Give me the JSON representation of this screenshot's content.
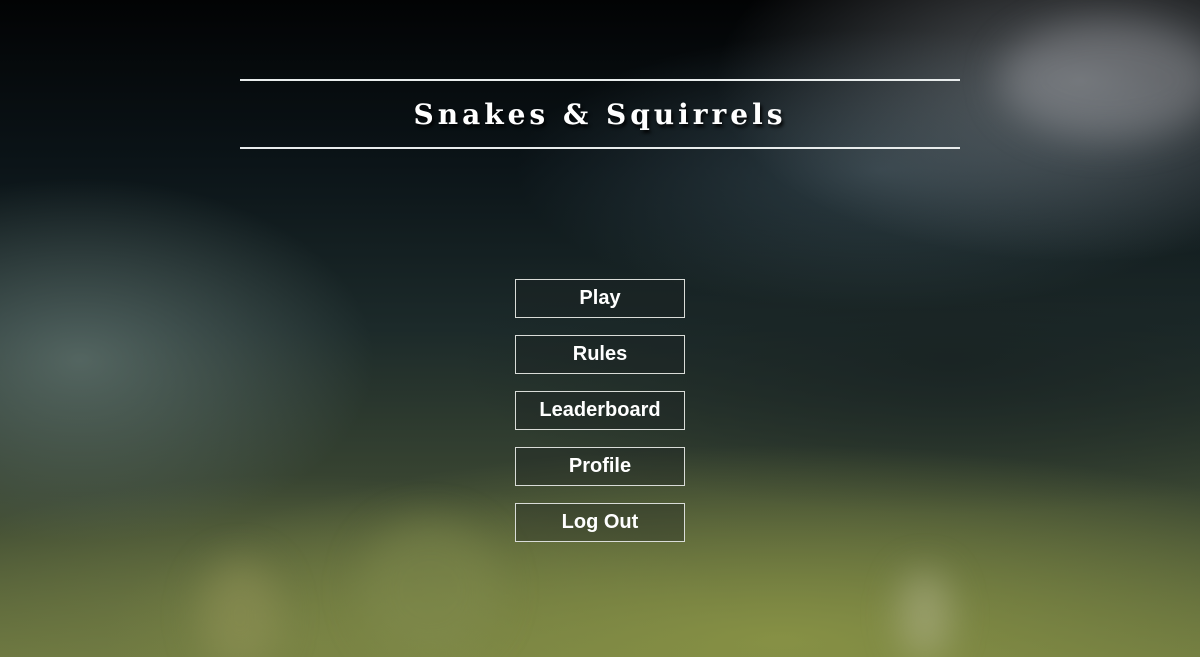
{
  "game": {
    "title": "Snakes & Squirrels"
  },
  "menu": {
    "items": [
      {
        "label": "Play"
      },
      {
        "label": "Rules"
      },
      {
        "label": "Leaderboard"
      },
      {
        "label": "Profile"
      },
      {
        "label": "Log Out"
      }
    ]
  },
  "colors": {
    "text": "#ffffff",
    "border": "#d9dcd8",
    "title_rule": "#e8ecec"
  }
}
